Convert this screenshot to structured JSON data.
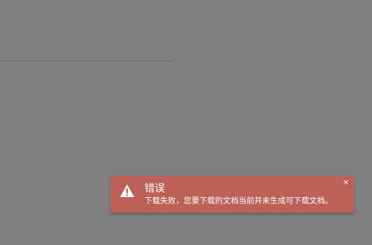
{
  "toast": {
    "type": "error",
    "icon": "warning-icon",
    "title": "错误",
    "message": "下载失败，您要下载的文档当前并未生成可下载文档。",
    "close_label": "×",
    "background_color": "#bd6158"
  },
  "overlay": {
    "color": "#7f7f7f"
  }
}
